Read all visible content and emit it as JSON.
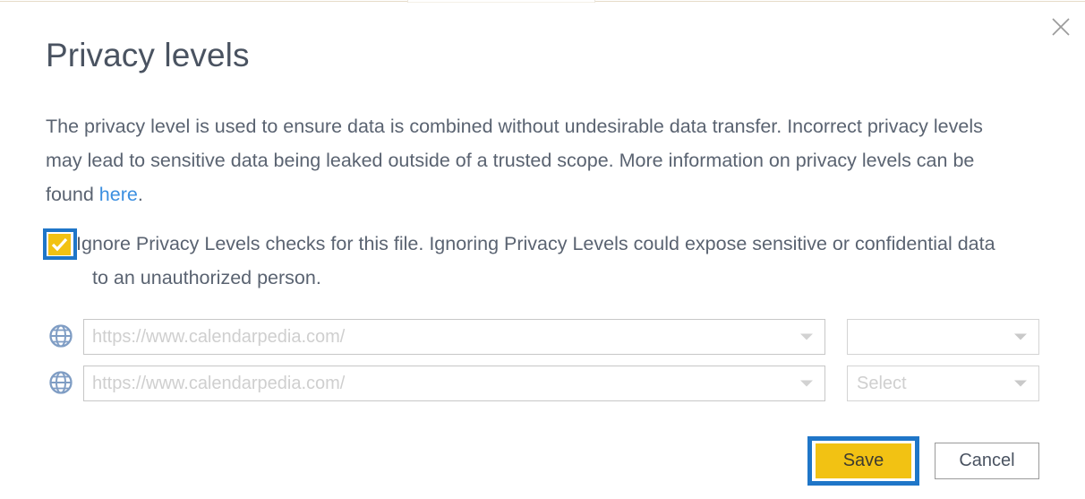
{
  "dialog": {
    "title": "Privacy levels",
    "close_icon": "close-icon",
    "description_part1": "The privacy level is used to ensure data is combined without undesirable data transfer. Incorrect privacy levels may lead to sensitive data being leaked outside of a trusted scope. More information on privacy levels can be found ",
    "description_link": "here",
    "description_part2": "."
  },
  "ignore_checkbox": {
    "checked": true,
    "check_icon": "checkmark-icon",
    "label_line1": "Ignore Privacy Levels checks for this file. Ignoring Privacy Levels could expose sensitive or confidential data",
    "label_line2": "to an unauthorized person.",
    "highlight_color": "#1f76c8",
    "box_color": "#f2c213"
  },
  "sources": [
    {
      "icon": "globe-icon",
      "url_placeholder": "https://www.calendarpedia.com/",
      "url_value": "",
      "level_placeholder": "",
      "level_value": "",
      "dropdown_icon": "chevron-down-icon"
    },
    {
      "icon": "globe-icon",
      "url_placeholder": "https://www.calendarpedia.com/",
      "url_value": "",
      "level_placeholder": "Select",
      "level_value": "",
      "dropdown_icon": "chevron-down-icon"
    }
  ],
  "footer": {
    "save_label": "Save",
    "cancel_label": "Cancel",
    "save_color": "#f2c213",
    "save_highlight_color": "#1f76c8"
  }
}
